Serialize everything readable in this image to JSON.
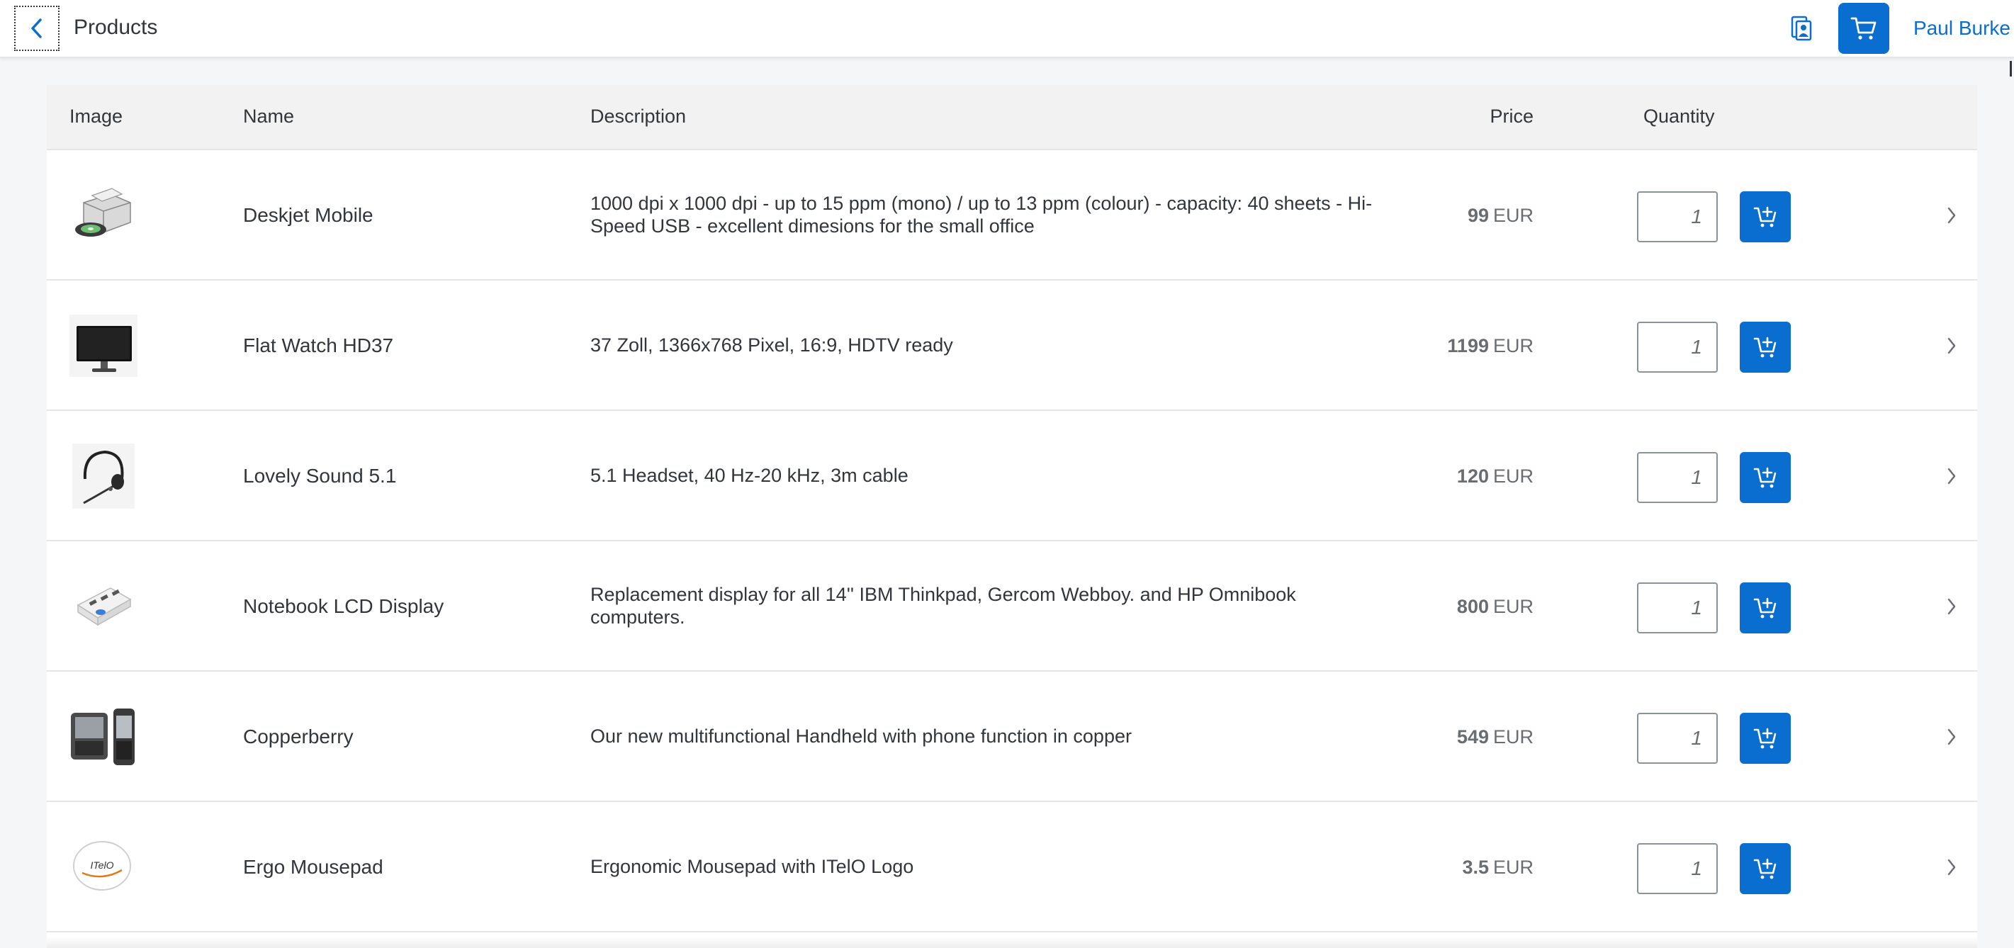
{
  "header": {
    "title": "Products",
    "user_name": "Paul Burke"
  },
  "table": {
    "columns": {
      "image": "Image",
      "name": "Name",
      "description": "Description",
      "price": "Price",
      "quantity": "Quantity"
    },
    "rows": [
      {
        "name": "Deskjet Mobile",
        "description": "1000 dpi x 1000 dpi - up to 15 ppm (mono) / up to 13 ppm (colour) - capacity: 40 sheets - Hi-Speed USB - excellent dimesions for the small office",
        "price": "99",
        "currency": "EUR",
        "quantity": "1",
        "image_icon": "printer-image"
      },
      {
        "name": "Flat Watch HD37",
        "description": "37 Zoll, 1366x768 Pixel, 16:9, HDTV ready",
        "price": "1199",
        "currency": "EUR",
        "quantity": "1",
        "image_icon": "monitor-image"
      },
      {
        "name": "Lovely Sound 5.1",
        "description": "5.1 Headset, 40 Hz-20 kHz, 3m cable",
        "price": "120",
        "currency": "EUR",
        "quantity": "1",
        "image_icon": "headset-image"
      },
      {
        "name": "Notebook LCD Display",
        "description": "Replacement display for all 14'' IBM Thinkpad, Gercom Webboy. and HP Omnibook computers.",
        "price": "800",
        "currency": "EUR",
        "quantity": "1",
        "image_icon": "usb-hub-image"
      },
      {
        "name": "Copperberry",
        "description": "Our new multifunctional Handheld with phone function in copper",
        "price": "549",
        "currency": "EUR",
        "quantity": "1",
        "image_icon": "handheld-image"
      },
      {
        "name": "Ergo Mousepad",
        "description": "Ergonomic Mousepad with ITelO Logo",
        "price": "3.5",
        "currency": "EUR",
        "quantity": "1",
        "image_icon": "mousepad-image",
        "logo_text": "ITelO"
      }
    ]
  },
  "colors": {
    "accent": "#0a6ed1",
    "text": "#32363a",
    "muted": "#6a6d70",
    "background": "#f5f6f7",
    "header_row": "#f2f2f2"
  }
}
